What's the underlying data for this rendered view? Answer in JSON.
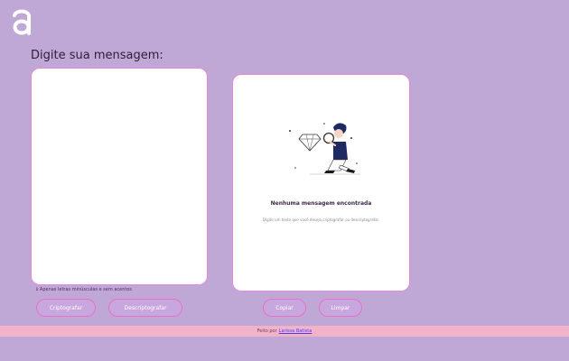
{
  "header": {
    "logo_icon": "alura-a-logo-icon"
  },
  "input": {
    "title": "Digite sua mensagem:",
    "text": "",
    "hint": "Apenas letras minúsculas e sem acentos"
  },
  "actions": {
    "encrypt_label": "Criptografar",
    "decrypt_label": "Descriptografar",
    "copy_label": "Copiar",
    "clear_label": "Limpar"
  },
  "output": {
    "title": "Nenhuma mensagem encontrada",
    "subtitle": "Digite um texto que você deseja criptografar ou descriptografar."
  },
  "footer": {
    "prefix": "Feito por",
    "author": "Larissa Batista"
  },
  "colors": {
    "background": "#c0a8d6",
    "accent_border": "#e870c9",
    "footer_bg": "#f2b3c8"
  }
}
